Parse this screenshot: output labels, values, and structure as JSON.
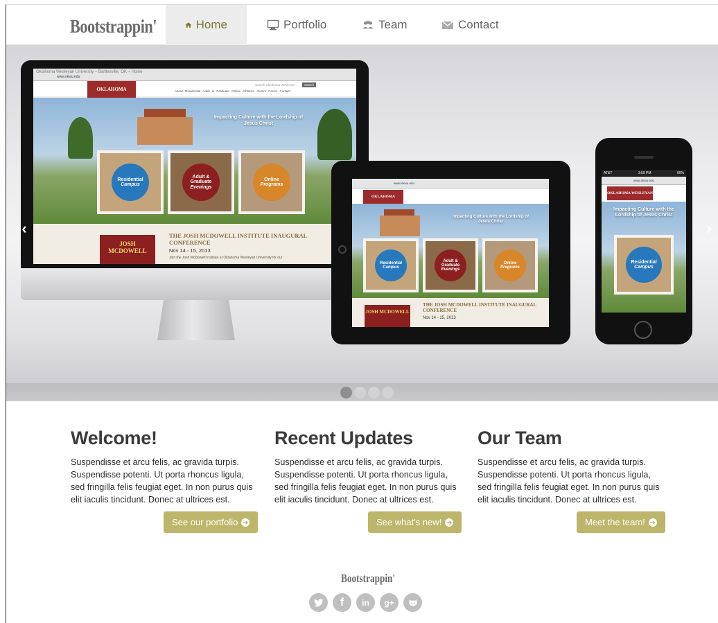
{
  "navbar": {
    "brand": "Bootstrappin'",
    "items": [
      {
        "label": "Home",
        "icon": "home-icon",
        "active": true
      },
      {
        "label": "Portfolio",
        "icon": "desktop-icon",
        "active": false
      },
      {
        "label": "Team",
        "icon": "group-icon",
        "active": false
      },
      {
        "label": "Contact",
        "icon": "envelope-icon",
        "active": false
      }
    ]
  },
  "carousel": {
    "prev": "‹",
    "next": "›",
    "slide_count": 4,
    "active_slide": 1,
    "mockup": {
      "url": "www.okwu.edu",
      "window_title": "Oklahoma Wesleyan University – Bartlesville, OK – Home",
      "logo": "OKLAHOMA WESLEYAN",
      "search_placeholder": "Search Oklahoma Wesleyan",
      "search_button": "Search",
      "menu": [
        "About",
        "Residential",
        "Adult & Graduate",
        "Online",
        "Athletics",
        "Alumni",
        "Forum",
        "Contact"
      ],
      "slogan": "Impacting Culture with the Lordship of Jesus Christ",
      "cards": [
        {
          "line1": "Residential",
          "line2": "Campus"
        },
        {
          "line1": "Adult & Graduate",
          "line2": "Evenings"
        },
        {
          "line1": "Online",
          "line2": "Programs"
        }
      ],
      "news_title": "THE JOSH MCDOWELL INSTITUTE INAUGURAL CONFERENCE",
      "news_date": "Nov 14 - 15, 2013",
      "news_text": "Join the Josh McDowell Institute at Oklahoma Wesleyan University for our",
      "book_text": "JOSH MCDOWELL",
      "phone_time": "3:59 PM",
      "phone_carrier": "AT&T",
      "phone_battery": "60%"
    }
  },
  "columns": [
    {
      "title": "Welcome!",
      "body": "Suspendisse et arcu felis, ac gravida turpis. Suspendisse potenti. Ut porta rhoncus ligula, sed fringilla felis feugiat eget. In non purus quis elit iaculis tincidunt. Donec at ultrices est.",
      "button": "See our portfolio"
    },
    {
      "title": "Recent Updates",
      "body": "Suspendisse et arcu felis, ac gravida turpis. Suspendisse potenti. Ut porta rhoncus ligula, sed fringilla felis feugiat eget. In non purus quis elit iaculis tincidunt. Donec at ultrices est.",
      "button": "See what's new!"
    },
    {
      "title": "Our Team",
      "body": "Suspendisse et arcu felis, ac gravida turpis. Suspendisse potenti. Ut porta rhoncus ligula, sed fringilla felis feugiat eget. In non purus quis elit iaculis tincidunt. Donec at ultrices est.",
      "button": "Meet the team!"
    }
  ],
  "footer": {
    "brand": "Bootstrappin'",
    "socials": [
      {
        "name": "twitter-icon",
        "glyph": "t"
      },
      {
        "name": "facebook-icon",
        "glyph": "f"
      },
      {
        "name": "linkedin-icon",
        "glyph": "in"
      },
      {
        "name": "google-plus-icon",
        "glyph": "g+"
      },
      {
        "name": "github-icon",
        "glyph": "gh"
      }
    ]
  },
  "colors": {
    "accent": "#bdb66a",
    "nav_active_text": "#7d7838",
    "nav_active_bg": "#ececec",
    "social": "#bfbfbf"
  }
}
